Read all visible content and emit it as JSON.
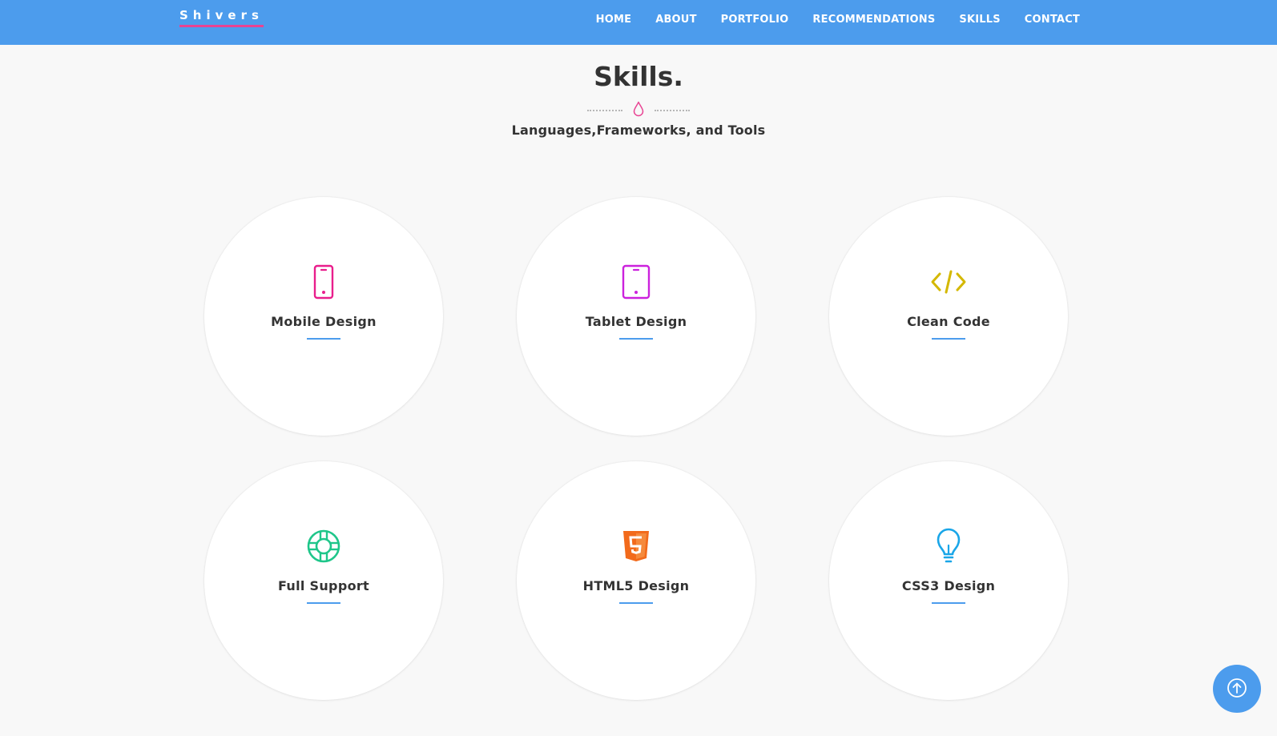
{
  "navbar": {
    "brand": "Shivers",
    "background_color": "#4c9ced",
    "brand_underline_color": "#e84393",
    "links": [
      "HOME",
      "ABOUT",
      "PORTFOLIO",
      "RECOMMENDATIONS",
      "SKILLS",
      "CONTACT"
    ]
  },
  "section": {
    "title": "Skills.",
    "subtitle": "Languages,Frameworks, and Tools",
    "divider_icon": "droplet-icon",
    "accent_color": "#e84393"
  },
  "skills": [
    {
      "label": "Mobile Design",
      "icon": "mobile-phone-icon",
      "color": "#e91e8c"
    },
    {
      "label": "Tablet Design",
      "icon": "tablet-icon",
      "color": "#cc22dd"
    },
    {
      "label": "Clean Code",
      "icon": "code-icon",
      "color": "#d4b800"
    },
    {
      "label": "Full Support",
      "icon": "lifebuoy-icon",
      "color": "#1fc68a"
    },
    {
      "label": "HTML5 Design",
      "icon": "html5-icon",
      "color": "#f26a1b"
    },
    {
      "label": "CSS3 Design",
      "icon": "lightbulb-icon",
      "color": "#1aa6e8"
    }
  ],
  "scroll_top": {
    "icon": "arrow-up-circle-icon"
  },
  "underline_color": "#4c9ced"
}
